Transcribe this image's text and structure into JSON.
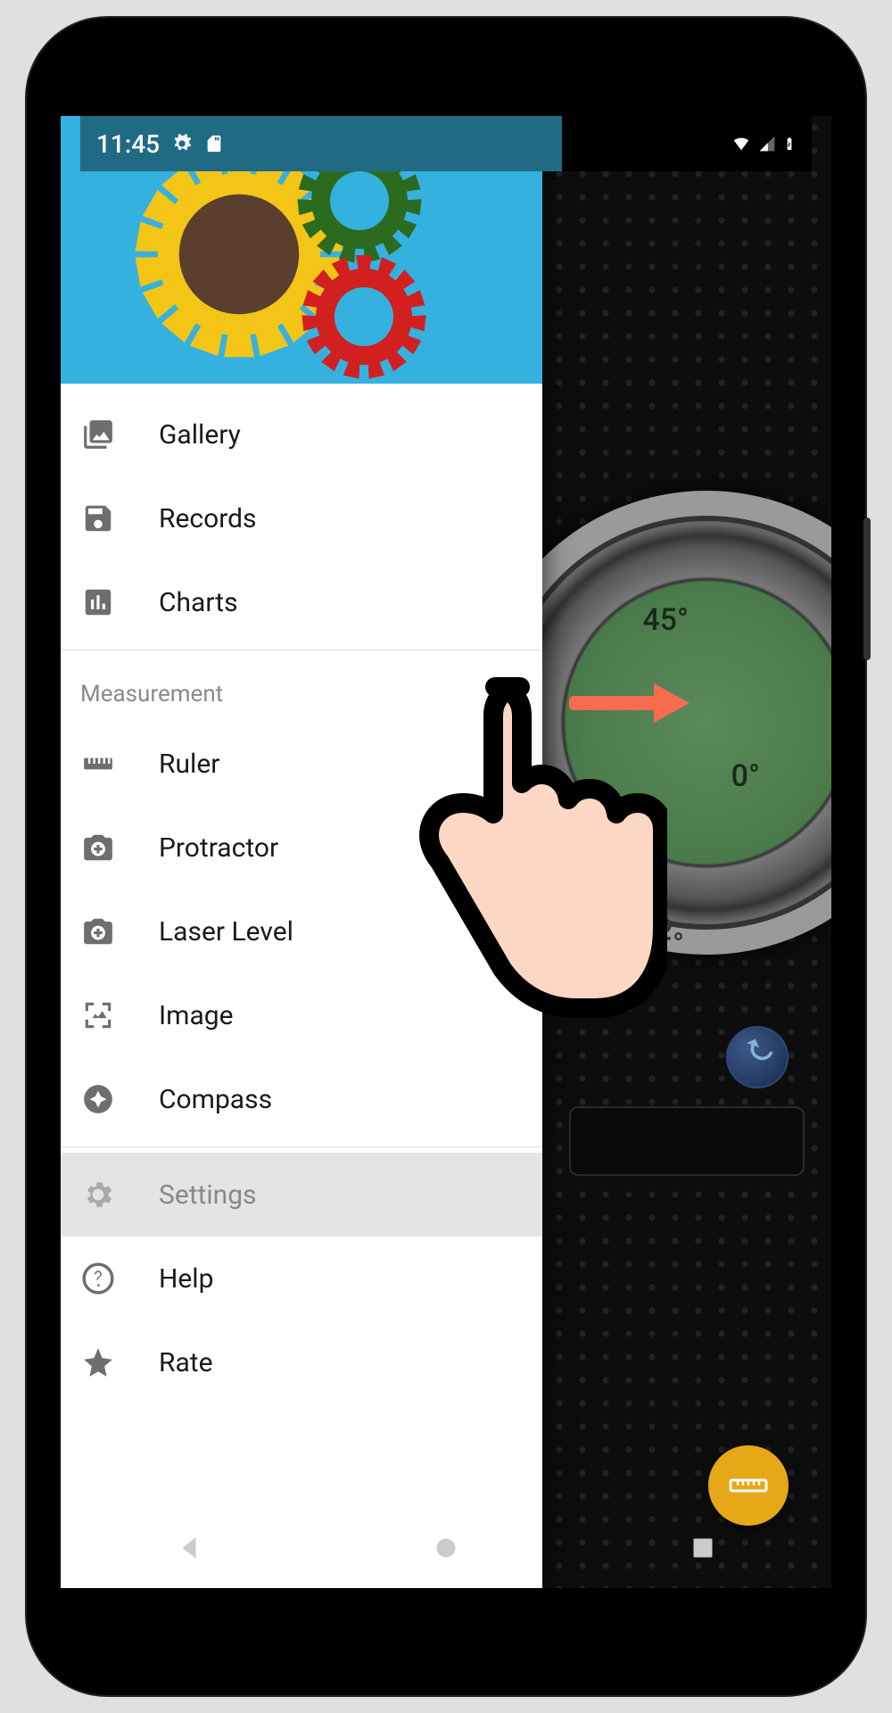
{
  "statusbar": {
    "time": "11:45"
  },
  "drawer": {
    "section1": [
      {
        "label": "Gallery",
        "icon": "gallery"
      },
      {
        "label": "Records",
        "icon": "save"
      },
      {
        "label": "Charts",
        "icon": "chart"
      }
    ],
    "sectionHeader": "Measurement",
    "section2": [
      {
        "label": "Ruler",
        "icon": "ruler"
      },
      {
        "label": "Protractor",
        "icon": "camera-plus"
      },
      {
        "label": "Laser Level",
        "icon": "camera-plus"
      },
      {
        "label": "Image",
        "icon": "image-frame"
      },
      {
        "label": "Compass",
        "icon": "compass"
      }
    ],
    "section3": [
      {
        "label": "Settings",
        "icon": "gear",
        "selected": true
      },
      {
        "label": "Help",
        "icon": "help"
      },
      {
        "label": "Rate",
        "icon": "star"
      }
    ]
  },
  "dial": {
    "mark45": "45°",
    "mark0": "0°",
    "mark45b": "45°"
  }
}
